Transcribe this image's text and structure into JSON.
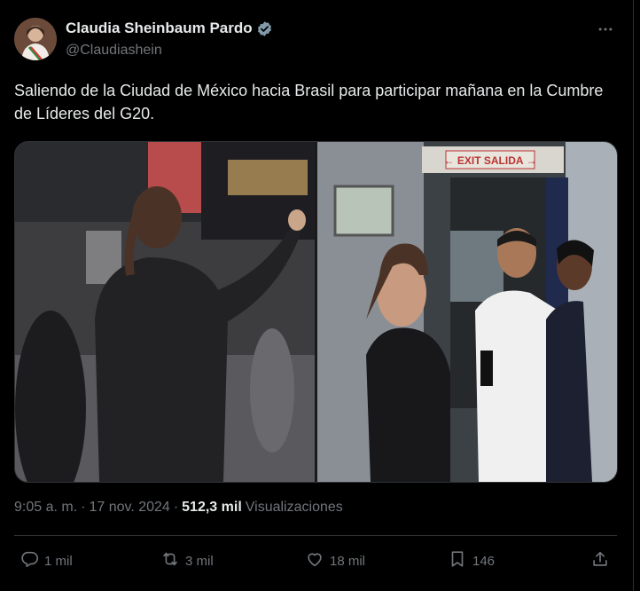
{
  "author": {
    "name": "Claudia Sheinbaum Pardo",
    "handle": "@Claudiashein",
    "verified_icon": "verified-badge-icon"
  },
  "tweet": {
    "text": "Saliendo de la Ciudad de México hacia Brasil para participar mañana en la Cumbre de Líderes del G20."
  },
  "media": {
    "photo_right_sign": "← EXIT SALIDA →"
  },
  "meta": {
    "time": "9:05 a. m.",
    "separator": "·",
    "date": "17 nov. 2024",
    "views_count": "512,3 mil",
    "views_label": "Visualizaciones"
  },
  "actions": {
    "replies": "1 mil",
    "reposts": "3 mil",
    "likes": "18 mil",
    "bookmarks": "146"
  },
  "colors": {
    "background": "#000000",
    "text": "#e7e9ea",
    "secondary": "#71767b",
    "border": "#2f3336",
    "verified": "#829aab"
  }
}
